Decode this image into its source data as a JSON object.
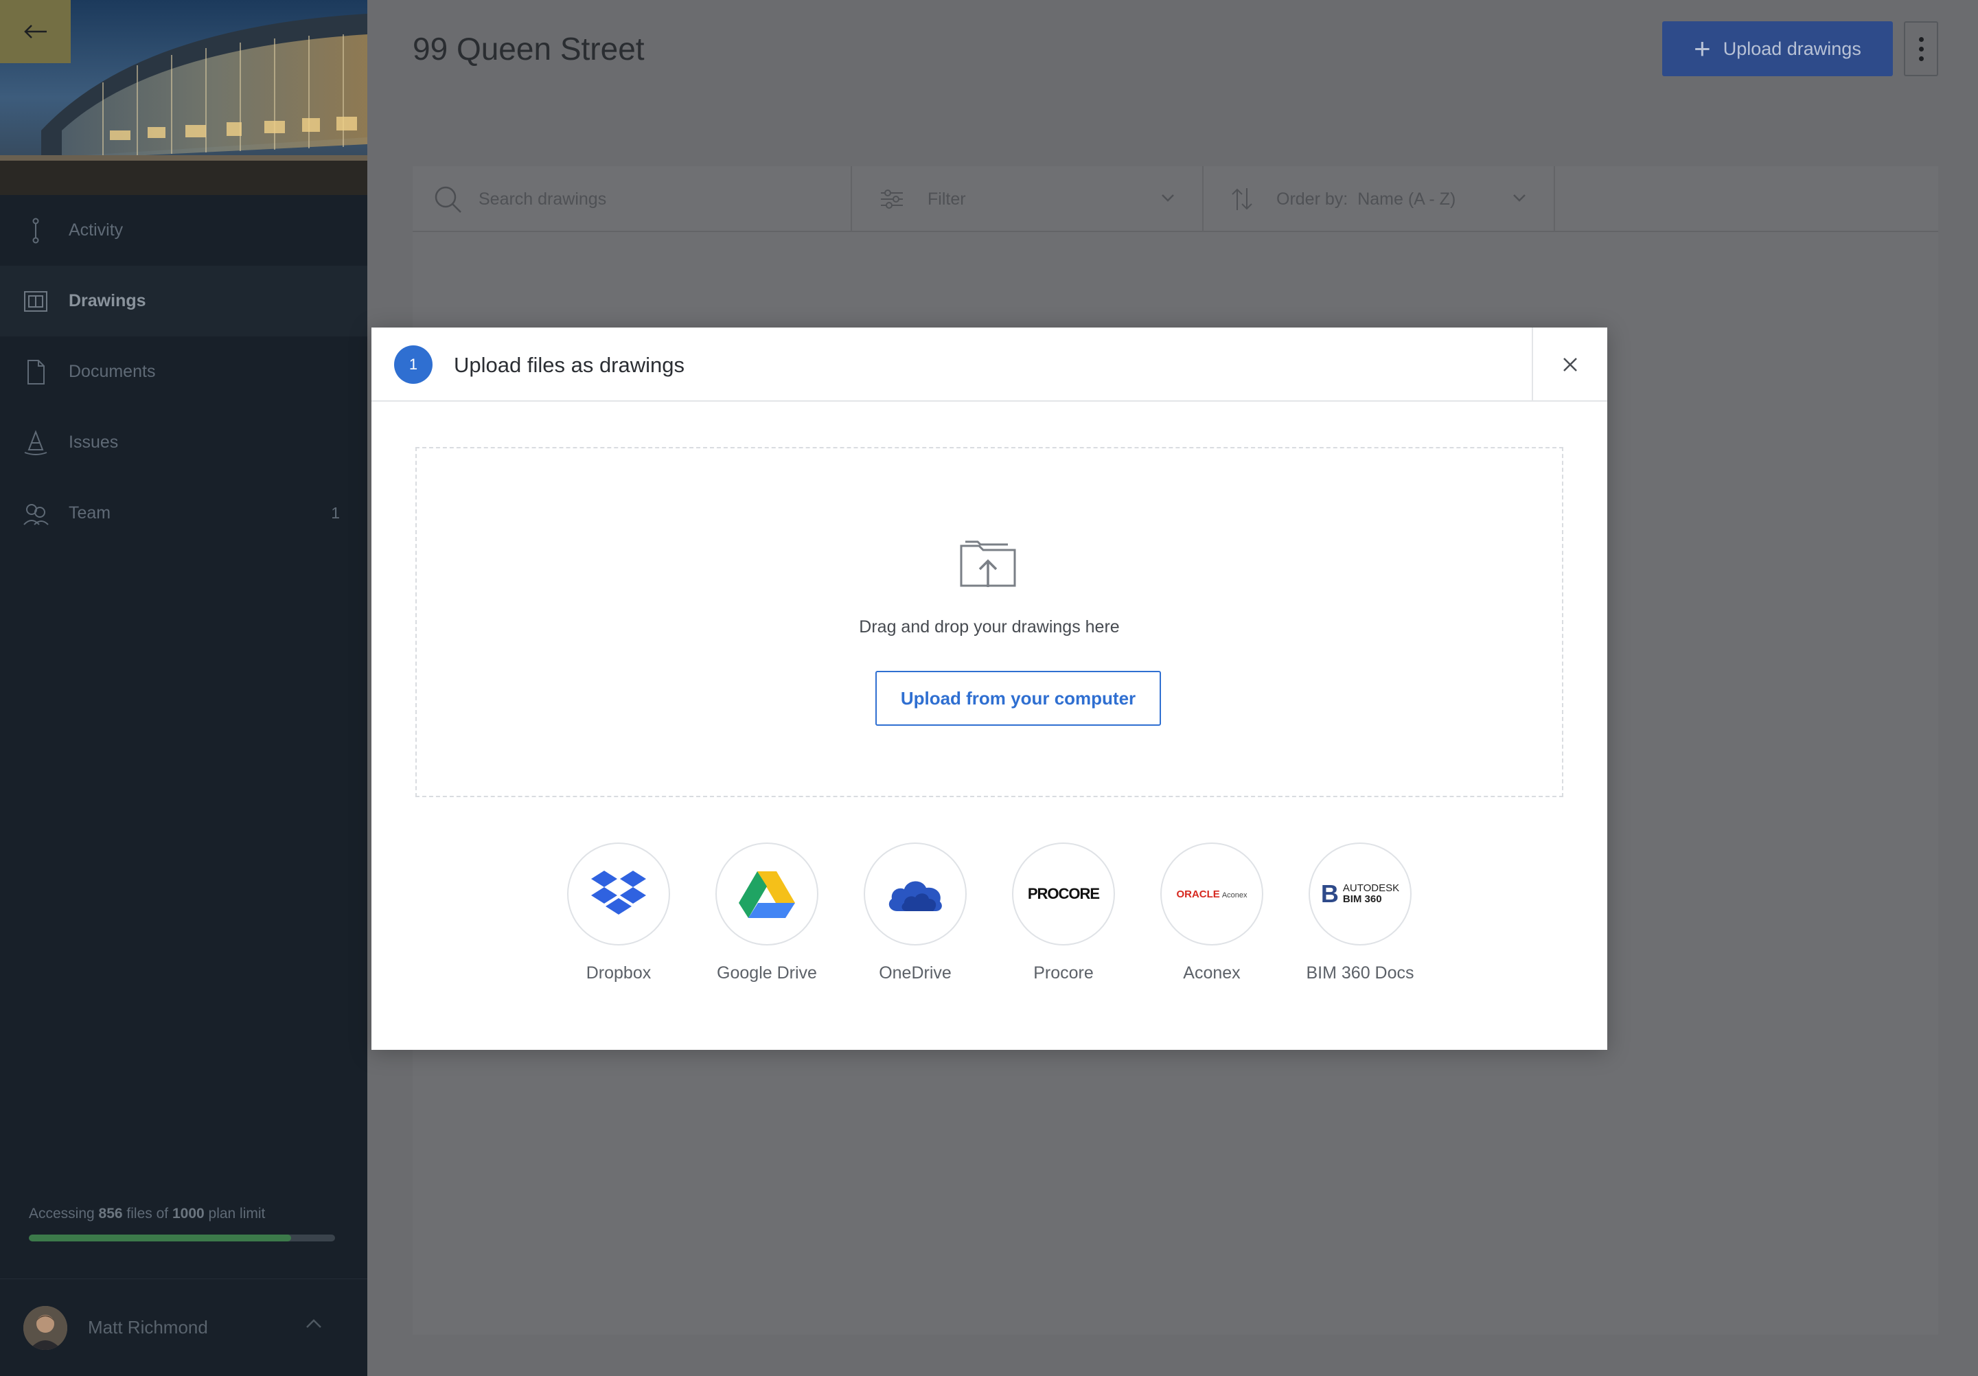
{
  "sidebar": {
    "back_icon": "arrow-left-icon",
    "nav": [
      {
        "label": "Activity",
        "icon": "activity-icon",
        "active": false,
        "count": ""
      },
      {
        "label": "Drawings",
        "icon": "drawings-icon",
        "active": true,
        "count": ""
      },
      {
        "label": "Documents",
        "icon": "documents-icon",
        "active": false,
        "count": ""
      },
      {
        "label": "Issues",
        "icon": "issues-icon",
        "active": false,
        "count": ""
      },
      {
        "label": "Team",
        "icon": "team-icon",
        "active": false,
        "count": "1"
      }
    ],
    "usage": {
      "prefix": "Accessing ",
      "used": "856",
      "middle": " files of ",
      "limit": "1000",
      "suffix": " plan limit",
      "fraction": 0.856,
      "bar_color": "#3c7a4a"
    },
    "user": {
      "name": "Matt Richmond"
    }
  },
  "header": {
    "title": "99 Queen Street",
    "upload_label": "Upload drawings",
    "upload_color": "#2e4b8a"
  },
  "toolbar": {
    "search_placeholder": "Search drawings",
    "filter_label": "Filter",
    "order_label": "Order by:",
    "order_value": "Name (A - Z)"
  },
  "modal": {
    "step": "1",
    "title": "Upload files as drawings",
    "drop_text": "Drag and drop your drawings here",
    "upload_button": "Upload from your computer",
    "accent": "#2f6fd1",
    "providers": [
      {
        "label": "Dropbox",
        "icon": "dropbox-icon"
      },
      {
        "label": "Google Drive",
        "icon": "google-drive-icon"
      },
      {
        "label": "OneDrive",
        "icon": "onedrive-icon"
      },
      {
        "label": "Procore",
        "icon": "procore-logo",
        "logo_text": "PROCORE"
      },
      {
        "label": "Aconex",
        "icon": "aconex-logo",
        "logo_text": "ORACLE",
        "logo_sub": "Aconex"
      },
      {
        "label": "BIM 360 Docs",
        "icon": "bim360-logo",
        "logo_text": "AUTODESK",
        "logo_sub": "BIM 360"
      }
    ]
  }
}
